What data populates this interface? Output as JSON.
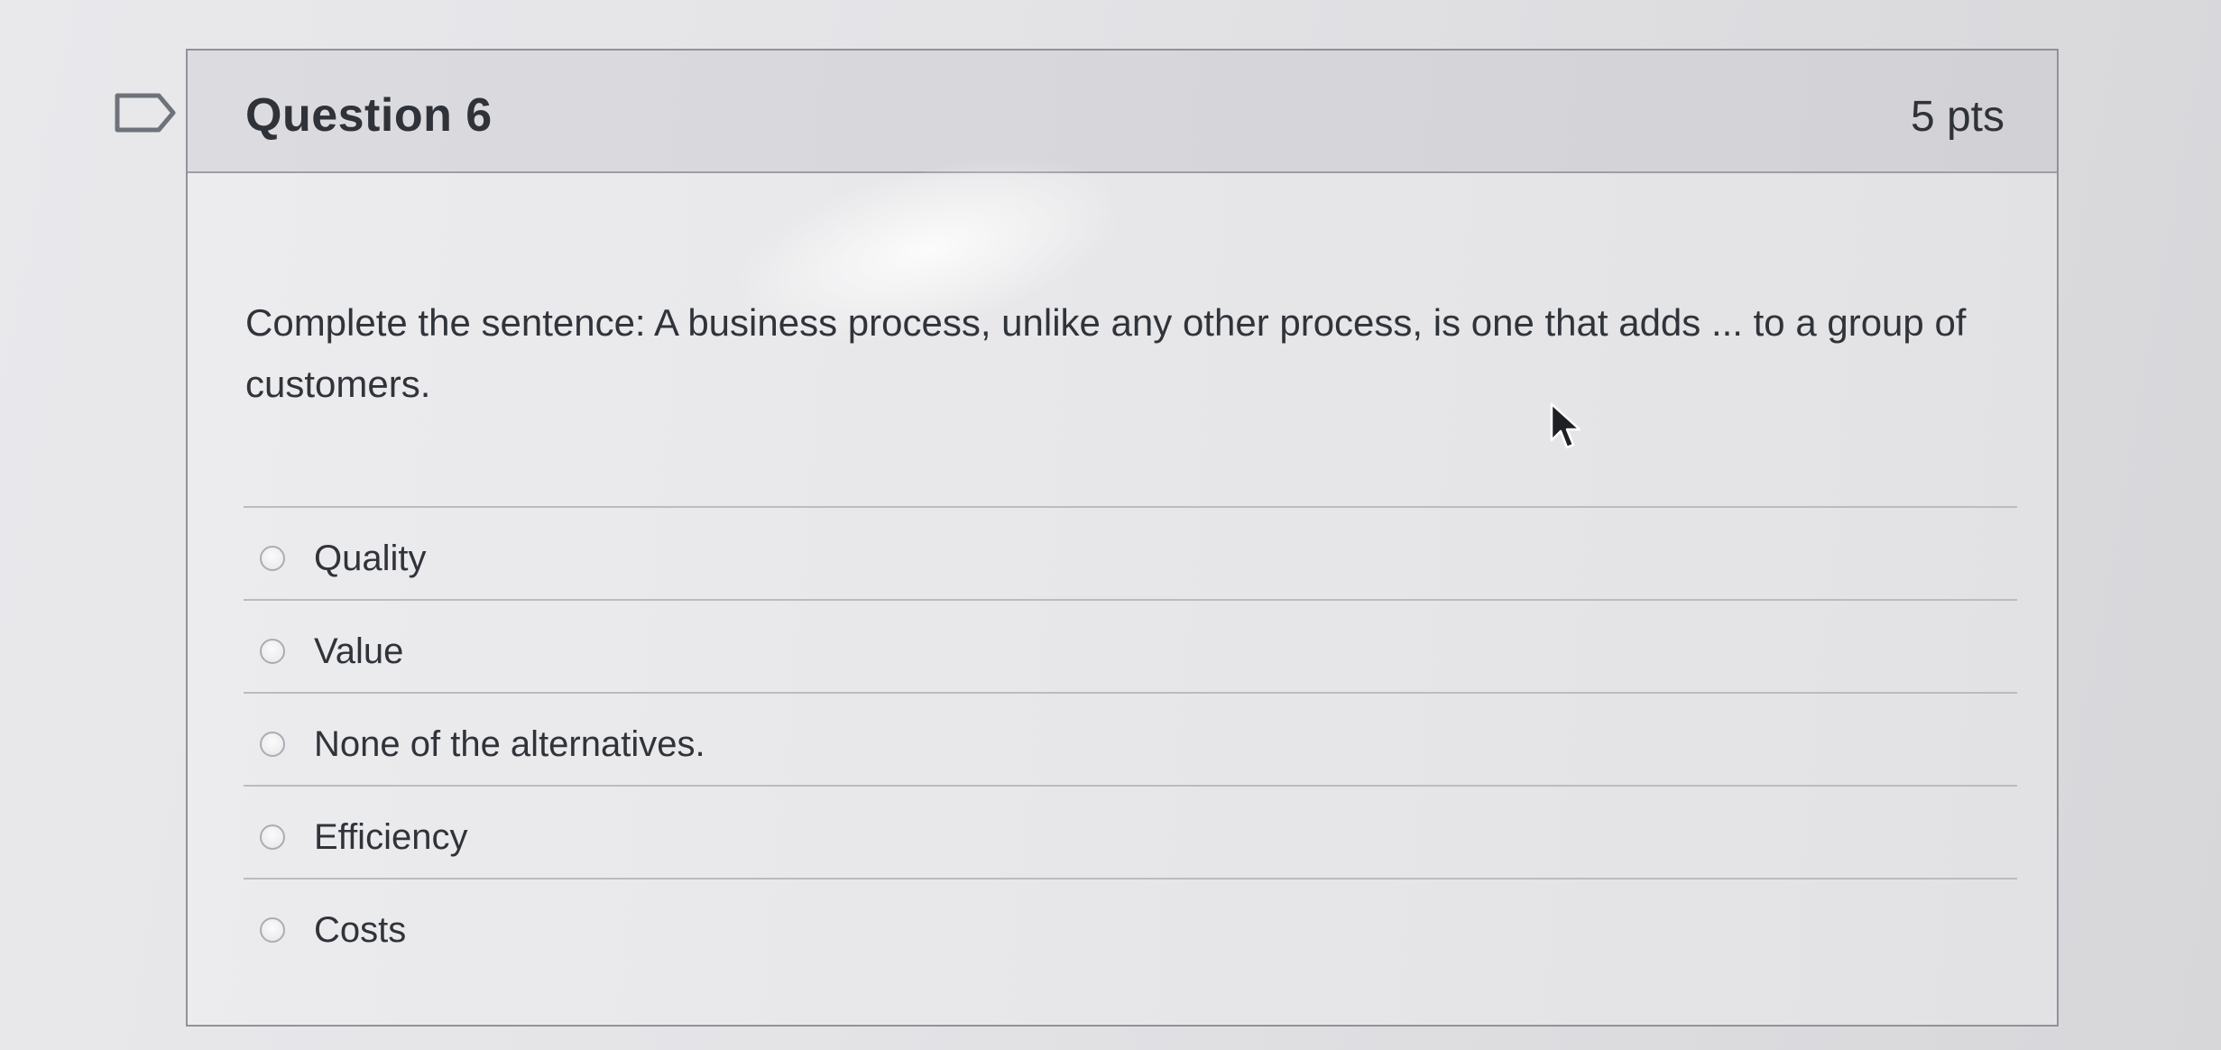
{
  "question": {
    "title": "Question 6",
    "points": "5 pts",
    "text": "Complete the sentence: A business process, unlike any other process, is one that adds ... to a group of customers."
  },
  "answers": [
    {
      "label": "Quality"
    },
    {
      "label": "Value"
    },
    {
      "label": "None of the alternatives."
    },
    {
      "label": "Efficiency"
    },
    {
      "label": "Costs"
    }
  ],
  "icons": {
    "flag": "flag-icon",
    "radio": "radio-button-icon",
    "cursor": "mouse-pointer-icon"
  },
  "colors": {
    "text": "#30343a",
    "header_bg": "#d6d6da",
    "border": "#8f939a"
  }
}
